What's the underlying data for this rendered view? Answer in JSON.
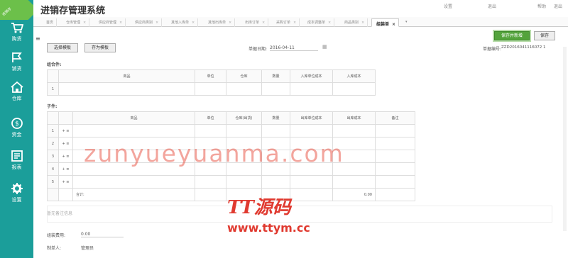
{
  "sidebar": {
    "badge": "进销存",
    "items": [
      {
        "label": "购货",
        "icon": "cart-icon"
      },
      {
        "label": "销货",
        "icon": "flag-icon"
      },
      {
        "label": "仓库",
        "icon": "warehouse-icon"
      },
      {
        "label": "资金",
        "icon": "coin-icon"
      },
      {
        "label": "报表",
        "icon": "report-icon"
      },
      {
        "label": "设置",
        "icon": "gear-icon"
      }
    ]
  },
  "header": {
    "title": "进销存管理系统",
    "links": [
      "设置",
      "退出",
      "帮助",
      "退出"
    ]
  },
  "tabs": [
    {
      "label": "首页"
    },
    {
      "label": "仓库管理"
    },
    {
      "label": "供应商管理"
    },
    {
      "label": "供应商类别"
    },
    {
      "label": "其他入库单"
    },
    {
      "label": "其他出库单"
    },
    {
      "label": "出库订单"
    },
    {
      "label": "采购订单"
    },
    {
      "label": "成本调整单"
    },
    {
      "label": "商品类别"
    },
    {
      "label": "组装单",
      "active": true
    }
  ],
  "toolbar": {
    "save_new": "保存并新增",
    "save": "保存",
    "select_template": "选择模板",
    "save_template": "存为模板",
    "date_label": "单据日期:",
    "date_value": "2016-04-11",
    "bill_label": "单据编号:",
    "bill_value": "ZZD2016041116072 1"
  },
  "parent": {
    "section_label": "组合件:",
    "headers": [
      "商品",
      "单位",
      "仓库",
      "数量",
      "入库单位成本",
      "入库成本"
    ],
    "rows": [
      {
        "num": "1"
      }
    ]
  },
  "child": {
    "section_label": "子件:",
    "headers": [
      "商品",
      "单位",
      "仓库(出货)",
      "数量",
      "出库单位成本",
      "出库成本",
      "备注"
    ],
    "rows": [
      {
        "num": "1",
        "ops": "+ ≡"
      },
      {
        "num": "2",
        "ops": "+ ≡"
      },
      {
        "num": "3",
        "ops": "+ ≡"
      },
      {
        "num": "4",
        "ops": "+ ≡"
      },
      {
        "num": "5",
        "ops": "+ ≡"
      }
    ],
    "total_label": "合计:",
    "total_value": "0.00"
  },
  "footer": {
    "memo_placeholder": "暂无备注信息",
    "fee_label": "组装费用:",
    "fee_value": "0.00",
    "maker_label": "制单人:",
    "maker_value": "管理员"
  },
  "watermark": {
    "domain": "zunyueyuanma.com",
    "logo": "TT源码",
    "url": "www.ttym.cc"
  },
  "colors": {
    "sidebar": "#1b9e9a",
    "primary_button": "#53a33b",
    "watermark": "#e03a30"
  }
}
